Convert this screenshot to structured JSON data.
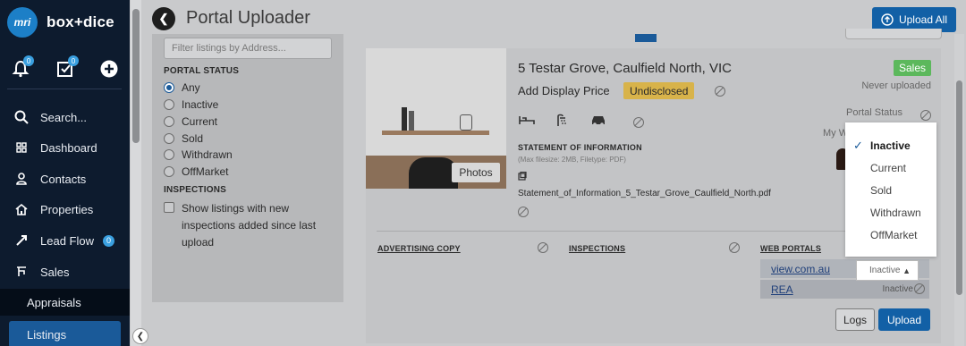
{
  "brand": {
    "logo_mark": "mri",
    "name": "box+dice"
  },
  "sidebar": {
    "notifications": {
      "icon": "bell-icon",
      "count": "0"
    },
    "tasks": {
      "icon": "task-check-icon",
      "count": "0"
    },
    "add": {
      "icon": "plus-circle-icon"
    },
    "items": [
      {
        "label": "Search...",
        "icon": "search-icon"
      },
      {
        "label": "Dashboard",
        "icon": "dashboard-icon"
      },
      {
        "label": "Contacts",
        "icon": "person-icon"
      },
      {
        "label": "Properties",
        "icon": "house-icon"
      },
      {
        "label": "Lead Flow",
        "icon": "lead-flow-icon",
        "count": "0"
      },
      {
        "label": "Sales",
        "icon": "sales-icon"
      }
    ],
    "sub_items": [
      {
        "label": "Appraisals"
      },
      {
        "label": "Listings",
        "active": true
      }
    ]
  },
  "header": {
    "title": "Portal Uploader",
    "upload_all": "Upload All"
  },
  "filter": {
    "search_placeholder": "Filter listings by Address...",
    "portal_status_title": "PORTAL STATUS",
    "portal_status_options": [
      "Any",
      "Inactive",
      "Current",
      "Sold",
      "Withdrawn",
      "OffMarket"
    ],
    "selected": "Any",
    "inspections_title": "INSPECTIONS",
    "inspections_checkbox": "Show listings with new inspections added since last upload"
  },
  "listing": {
    "address": "5 Testar Grove, Caulfield North, VIC",
    "status": "Sales",
    "upload_state": "Never uploaded",
    "display_price_label": "Add Display Price",
    "price_value": "Undisclosed",
    "photos_label": "Photos",
    "portal_status_label": "Portal Status",
    "my_web_label": "My W",
    "soi": {
      "title": "STATEMENT OF INFORMATION",
      "note": "(Max filesize: 2MB, Filetype: PDF)",
      "file": "Statement_of_Information_5_Testar_Grove_Caulfield_North.pdf"
    },
    "sections": {
      "advertising": "ADVERTISING COPY",
      "inspections": "INSPECTIONS",
      "web_portals": "WEB PORTALS"
    },
    "portals": [
      {
        "name": "view.com.au",
        "status": "Inactive"
      },
      {
        "name": "REA",
        "status": "Inactive"
      }
    ],
    "logs": "Logs",
    "upload": "Upload"
  },
  "dropdown": {
    "options": [
      "Inactive",
      "Current",
      "Sold",
      "Withdrawn",
      "OffMarket"
    ],
    "selected": "Inactive"
  },
  "colors": {
    "accent": "#1260a6",
    "sales": "#5cb85c",
    "undisclosed": "#d8b34a"
  }
}
